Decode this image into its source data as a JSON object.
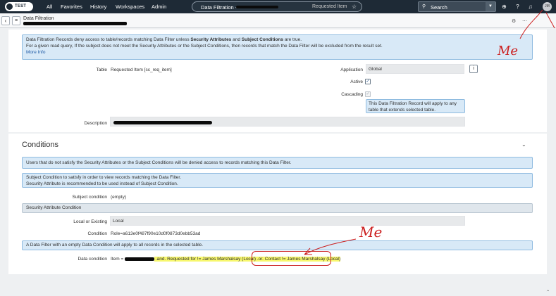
{
  "nav": {
    "logo_text": "TEST",
    "menu": [
      "All",
      "Favorites",
      "History",
      "Workspaces",
      "Admin"
    ],
    "page_pill_title": "Data Filtration -",
    "page_pill_sub": "Requested Item",
    "search_label": "Search",
    "avatar_initials": "JM"
  },
  "form_header": {
    "title": "Data Filtration"
  },
  "info_top": {
    "line1_a": "Data Filtration Records deny access to table/records matching Data Filter unless ",
    "line1_b": "Security Attributes",
    "line1_c": " and ",
    "line1_d": "Subject Conditions",
    "line1_e": " are true.",
    "line2": "For a given read query, If the subject does not meet the Security Attributes or the Subject Conditions, then records that match the Data Filter will be excluded from the result set.",
    "more_info": "More Info"
  },
  "fields": {
    "table_label": "Table",
    "table_value": "Requested Item [sc_req_item]",
    "application_label": "Application",
    "application_value": "Global",
    "active_label": "Active",
    "cascading_label": "Cascading",
    "cascading_hint": "This Data Filtration Record will apply to any table that extends selected table.",
    "description_label": "Description"
  },
  "conditions": {
    "title": "Conditions",
    "info1": "Users that do not satisfy the Security Attributes or the Subject Conditions will be denied access to records matching this Data Filter.",
    "info2_line1": "Subject Condition to satisfy in order to view records matching the Data Filter.",
    "info2_line2": "Security Attribute is recommended to be used instead of Subject Condition.",
    "subject_label": "Subject condition",
    "subject_value": "(empty)",
    "security_attr_header": "Security Attribute Condition",
    "local_label": "Local or Existing",
    "local_value": "Local",
    "condition_label": "Condition",
    "condition_value": "Role=a613e0f487f90e10d0f0873d0ebb53ad",
    "info3": "A Data Filter with an empty Data Condition will apply to all records in the selected table.",
    "data_condition_label": "Data condition",
    "data_condition_prefix": "Item =",
    "data_condition_mid": " .and. Requested for != James Marshalsay (Local) .or. ",
    "data_condition_tail": "Contact != James Marshalsay (Local)"
  },
  "annotations": {
    "me_top": "Me",
    "me_bottom": "Me"
  },
  "colors": {
    "nav_bg": "#1e2a36",
    "info_bg": "#d8e9f7",
    "info_border": "#8fbbe0",
    "highlight": "#f7f76c",
    "annotation": "#cc1f1f"
  }
}
